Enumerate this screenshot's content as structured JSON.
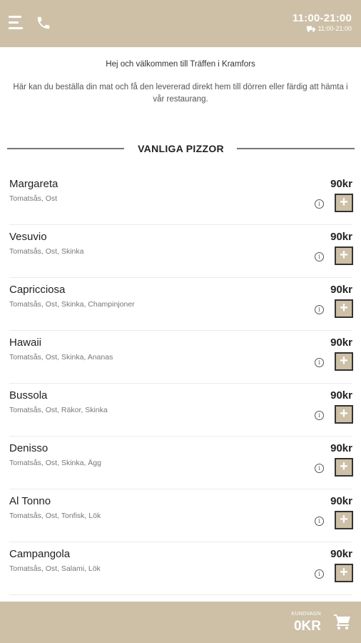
{
  "header": {
    "hours_main": "11:00-21:00",
    "hours_delivery": "11:00-21:00",
    "menu_icon": "menu-icon",
    "phone_icon": "phone-icon",
    "truck_icon": "delivery-truck-icon"
  },
  "welcome": {
    "title": "Hej och välkommen till Träffen i Kramfors",
    "text": "Här kan du beställa din mat och få den levererad direkt hem till dörren eller färdig att hämta i vår restaurang."
  },
  "section": {
    "title": "VANLIGA PIZZOR"
  },
  "items": [
    {
      "name": "Margareta",
      "desc": "Tomatsås, Ost",
      "price": "90kr"
    },
    {
      "name": "Vesuvio",
      "desc": "Tomatsås, Ost, Skinka",
      "price": "90kr"
    },
    {
      "name": "Capricciosa",
      "desc": "Tomatsås, Ost, Skinka, Champinjoner",
      "price": "90kr"
    },
    {
      "name": "Hawaii",
      "desc": "Tomatsås, Ost, Skinka, Ananas",
      "price": "90kr"
    },
    {
      "name": "Bussola",
      "desc": "Tomatsås, Ost, Räkor, Skinka",
      "price": "90kr"
    },
    {
      "name": "Denisso",
      "desc": "Tomatsås, Ost, Skinka, Ägg",
      "price": "90kr"
    },
    {
      "name": "Al Tonno",
      "desc": "Tomatsås, Ost, Tonfisk, Lök",
      "price": "90kr"
    },
    {
      "name": "Campangola",
      "desc": "Tomatsås, Ost, Salami, Lök",
      "price": "90kr"
    }
  ],
  "item_controls": {
    "info_symbol": "i",
    "add_symbol": "+"
  },
  "cart": {
    "label": "KUNDVAGN",
    "total": "0KR",
    "icon": "shopping-cart-icon"
  },
  "colors": {
    "brand": "#cdc0a7",
    "text": "#222222",
    "muted": "#777777"
  }
}
